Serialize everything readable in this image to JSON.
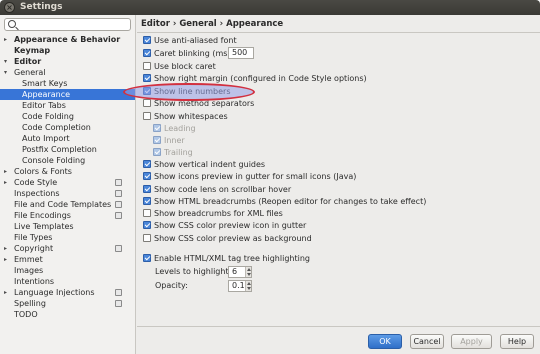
{
  "window": {
    "title": "Settings"
  },
  "search": {
    "placeholder": ""
  },
  "breadcrumb": {
    "text": "Editor › General › Appearance"
  },
  "sidebar": {
    "items": [
      {
        "label": "Appearance & Behavior",
        "arrow": "▸",
        "bold": true
      },
      {
        "label": "Keymap",
        "arrow": "",
        "bold": true
      },
      {
        "label": "Editor",
        "arrow": "▾",
        "bold": true
      },
      {
        "label": "General",
        "arrow": "▾"
      },
      {
        "label": "Smart Keys",
        "arrow": ""
      },
      {
        "label": "Appearance",
        "arrow": "",
        "selected": true
      },
      {
        "label": "Editor Tabs",
        "arrow": ""
      },
      {
        "label": "Code Folding",
        "arrow": ""
      },
      {
        "label": "Code Completion",
        "arrow": ""
      },
      {
        "label": "Auto Import",
        "arrow": ""
      },
      {
        "label": "Postfix Completion",
        "arrow": ""
      },
      {
        "label": "Console Folding",
        "arrow": ""
      },
      {
        "label": "Colors & Fonts",
        "arrow": "▸"
      },
      {
        "label": "Code Style",
        "arrow": "▸",
        "project_icon": true
      },
      {
        "label": "Inspections",
        "arrow": "",
        "project_icon": true
      },
      {
        "label": "File and Code Templates",
        "arrow": "",
        "project_icon": true
      },
      {
        "label": "File Encodings",
        "arrow": "",
        "project_icon": true
      },
      {
        "label": "Live Templates",
        "arrow": ""
      },
      {
        "label": "File Types",
        "arrow": ""
      },
      {
        "label": "Copyright",
        "arrow": "▸",
        "project_icon": true
      },
      {
        "label": "Emmet",
        "arrow": "▸"
      },
      {
        "label": "Images",
        "arrow": ""
      },
      {
        "label": "Intentions",
        "arrow": ""
      },
      {
        "label": "Language Injections",
        "arrow": "▸",
        "project_icon": true
      },
      {
        "label": "Spelling",
        "arrow": "",
        "project_icon": true
      },
      {
        "label": "TODO",
        "arrow": ""
      }
    ]
  },
  "options": {
    "anti_aliased": {
      "label": "Use anti-aliased font",
      "checked": true
    },
    "caret_blinking": {
      "label": "Caret blinking (ms):",
      "checked": true,
      "value": "500"
    },
    "block_caret": {
      "label": "Use block caret",
      "checked": false
    },
    "right_margin": {
      "label": "Show right margin (configured in Code Style options)",
      "checked": true
    },
    "line_numbers": {
      "label": "Show line numbers",
      "checked": true
    },
    "method_separators": {
      "label": "Show method separators",
      "checked": false
    },
    "whitespaces": {
      "label": "Show whitespaces",
      "checked": false
    },
    "ws_leading": {
      "label": "Leading",
      "checked": true
    },
    "ws_inner": {
      "label": "Inner",
      "checked": true
    },
    "ws_trailing": {
      "label": "Trailing",
      "checked": true
    },
    "indent_guides": {
      "label": "Show vertical indent guides",
      "checked": true
    },
    "small_icons": {
      "label": "Show icons preview in gutter for small icons (Java)",
      "checked": true
    },
    "code_lens": {
      "label": "Show code lens on scrollbar hover",
      "checked": true
    },
    "html_breadcrumbs": {
      "label": "Show HTML breadcrumbs (Reopen editor for changes to take effect)",
      "checked": true
    },
    "xml_breadcrumbs": {
      "label": "Show breadcrumbs for XML files",
      "checked": false
    },
    "css_icon": {
      "label": "Show CSS color preview icon in gutter",
      "checked": true
    },
    "css_background": {
      "label": "Show CSS color preview as background",
      "checked": false
    },
    "tag_tree": {
      "label": "Enable HTML/XML tag tree highlighting",
      "checked": true
    },
    "levels": {
      "label": "Levels to highlight:",
      "value": "6"
    },
    "opacity": {
      "label": "Opacity:",
      "value": "0.1"
    }
  },
  "footer": {
    "ok": "OK",
    "cancel": "Cancel",
    "apply": "Apply",
    "help": "Help"
  },
  "colors": {
    "selection": "#3875d7",
    "highlight_oval_stroke": "#d2303f",
    "primary_button": "#2f6fc8"
  }
}
